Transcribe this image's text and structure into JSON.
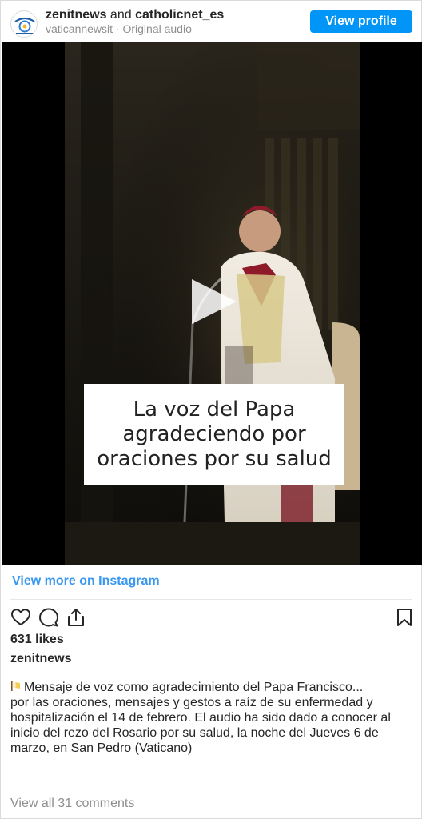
{
  "header": {
    "user1": "zenitnews",
    "and_text": "and",
    "user2": "catholicnet_es",
    "subtitle": "vaticannewsit · Original audio",
    "view_profile_label": "View profile"
  },
  "video": {
    "overlay_text": "La voz del Papa\nagradeciendo por\noraciones por su salud",
    "play_icon": "play-icon"
  },
  "view_more_label": "View more on Instagram",
  "actions": {
    "like_icon": "heart-icon",
    "comment_icon": "comment-icon",
    "share_icon": "share-icon",
    "save_icon": "bookmark-icon"
  },
  "likes_text": "631 likes",
  "poster": "zenitnews",
  "caption": {
    "emoji_icon": "flag-pennant-icon",
    "line1": "Mensaje de voz como agradecimiento del Papa Francisco...",
    "body": "por las oraciones, mensajes y gestos a raíz de su enfermedad y hospitalización el 14 de febrero. El audio ha sido dado a conocer al inicio del rezo del Rosario por su salud, la noche del Jueves 6 de marzo, en San Pedro (Vaticano)"
  },
  "comments_link": "View all 31 comments",
  "colors": {
    "accent": "#0095f6",
    "link": "#3897f0",
    "muted": "#8e8e8e",
    "text": "#262626"
  }
}
